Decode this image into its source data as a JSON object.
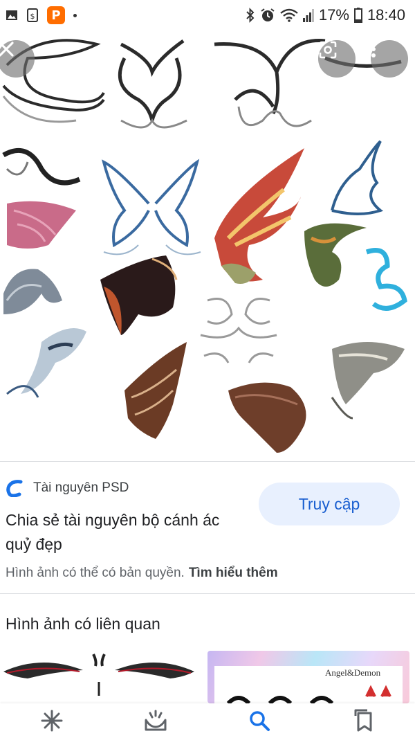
{
  "status_bar": {
    "battery": "17%",
    "time": "18:40",
    "icons": [
      "image-icon",
      "app-notification-icon",
      "p-app-icon",
      "bluetooth-icon",
      "alarm-icon",
      "wifi-icon",
      "signal-icon",
      "battery-icon"
    ],
    "p_app_letter": "P"
  },
  "image_viewer": {
    "close_icon": "close-icon",
    "lens_icon": "google-lens-icon",
    "more_icon": "more-vert-icon",
    "image_subject": "wings-collection"
  },
  "source": {
    "name": "Tài nguyên PSD",
    "icon": "source-logo-icon",
    "title": "Chia sẻ tài nguyên bộ cánh ác quỷ đẹp",
    "visit_label": "Truy cập"
  },
  "copyright": {
    "text": "Hình ảnh có thể có bản quyền.",
    "learn_more": "Tìm hiểu thêm"
  },
  "related": {
    "heading": "Hình ảnh có liên quan",
    "thumbnails": [
      {
        "caption": ""
      },
      {
        "caption": "Angel&Demon"
      }
    ]
  },
  "bottom_nav": {
    "items": [
      {
        "icon": "discover-icon"
      },
      {
        "icon": "updates-icon"
      },
      {
        "icon": "search-icon",
        "active": true
      },
      {
        "icon": "collections-icon"
      }
    ]
  },
  "colors": {
    "accent": "#1a73e8",
    "button_bg": "#e8f0fe",
    "source_logo": "#1a73e8"
  }
}
